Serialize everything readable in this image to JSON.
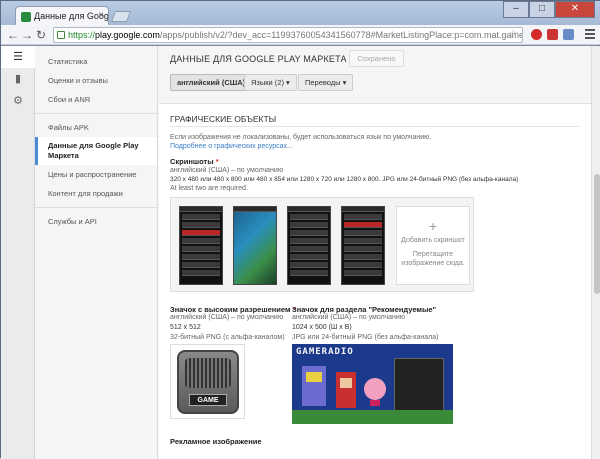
{
  "browser": {
    "tab_title": "Данные для Google Play",
    "url_protocol": "https://",
    "url_host": "play.google.com",
    "url_rest": "/apps/publish/v2/?dev_acc=11993760054341560778#MarketListingPlace:p=com.mat.gameradio"
  },
  "sidebar": {
    "group1": [
      "Статистика",
      "Оценки и отзывы",
      "Сбои и ANR"
    ],
    "group2_header": "Файлы APK",
    "active_item": "Данные для Google Play Маркета",
    "group2_rest": [
      "Цены и распространение",
      "Контент для продажи"
    ],
    "group3": [
      "Службы и API"
    ]
  },
  "header": {
    "title": "ДАННЫЕ ДЛЯ GOOGLE PLAY МАРКЕТА",
    "saved_label": "Сохранено",
    "lang_button": "английский (США)",
    "languages_button": "Языки (2) ▾",
    "translations_button": "Переводы ▾"
  },
  "graphics": {
    "section_title": "ГРАФИЧЕСКИЕ ОБЪЕКТЫ",
    "intro": "Если изображения не локализованы, будет использоваться язык по умолчанию.",
    "more_link": "Подробнее о графических ресурсах...",
    "screenshots_label": "Скриншоты",
    "screenshots_default": "английский (США) – по умолчанию",
    "screenshots_sizes": "320 x 480 или 480 x 800 или 480 x 854 или 1280 x 720 или 1280 x 800. JPG или 24-битный PNG (без альфа-канала)",
    "screenshots_hint": "At least two are required.",
    "add_screenshot": "Добавить скриншот",
    "drag_hint": "Перетащите изображение сюда.",
    "hires_label": "Значок с высоким разрешением",
    "hires_default": "английский (США) – по умолчанию",
    "hires_size": "512 x 512",
    "hires_format": "32-битный PNG (с альфа-каналом)",
    "featured_label": "Значок для раздела \"Рекомендуемые\"",
    "featured_default": "английский (США) – по умолчанию",
    "featured_size": "1024 x 500 (Ш x В)",
    "featured_format": "JPG или 24-битный PNG (без альфа-канала)",
    "promo_label": "Рекламное изображение",
    "icon_text": "GAME",
    "featured_text": "GAMERADIO"
  },
  "colors": {
    "accent": "#4a8cd7",
    "link": "#3b7cc9",
    "required": "#dd3333"
  }
}
